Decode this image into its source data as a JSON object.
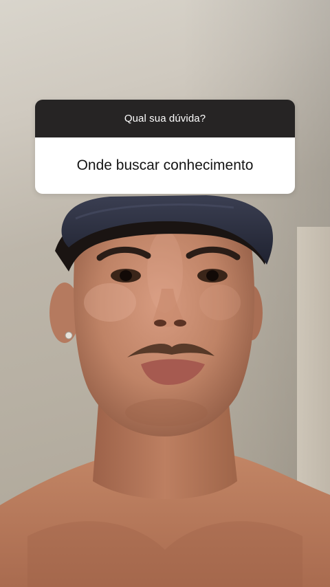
{
  "story": {
    "question_sticker": {
      "prompt": "Qual sua dúvida?",
      "answer": "Onde buscar conhecimento"
    }
  },
  "colors": {
    "sticker_header_bg": "#262424",
    "sticker_body_bg": "#ffffff",
    "cap": "#2d3040",
    "skin": "#b77c63"
  }
}
